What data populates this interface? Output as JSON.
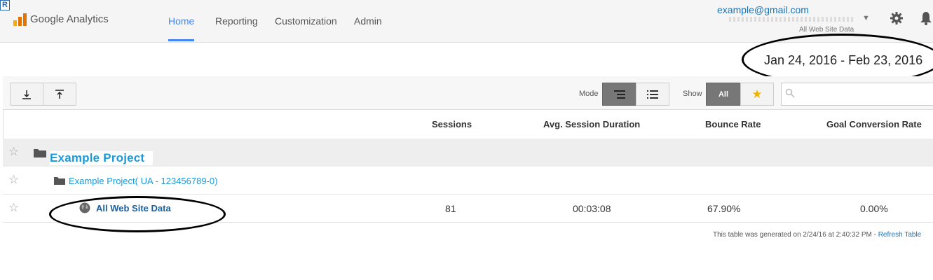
{
  "header": {
    "badge": "R",
    "app_name": "Google Analytics",
    "nav": [
      {
        "label": "Home"
      },
      {
        "label": "Reporting"
      },
      {
        "label": "Customization"
      },
      {
        "label": "Admin"
      }
    ],
    "account_email": "example@gmail.com",
    "account_view": "All Web Site Data"
  },
  "date_range": "Jan 24, 2016 - Feb 23, 2016",
  "toolbar": {
    "mode_label": "Mode",
    "show_label": "Show",
    "show_all": "All"
  },
  "table": {
    "columns": [
      "Sessions",
      "Avg. Session Duration",
      "Bounce Rate",
      "Goal Conversion Rate"
    ],
    "rows": [
      {
        "label": "Example  Project"
      },
      {
        "label": "Example Project( UA - 123456789-0)"
      },
      {
        "label": "All Web Site Data",
        "sessions": "81",
        "avg_duration": "00:03:08",
        "bounce_rate": "67.90%",
        "goal_conversion": "0.00%"
      }
    ]
  },
  "footer": {
    "text": "This table was generated on 2/24/16 at 2:40:32 PM - ",
    "link": "Refresh Table"
  },
  "colors": {
    "accent": "#4285f4",
    "link": "#1a9ad6",
    "annotation": "#000000"
  }
}
